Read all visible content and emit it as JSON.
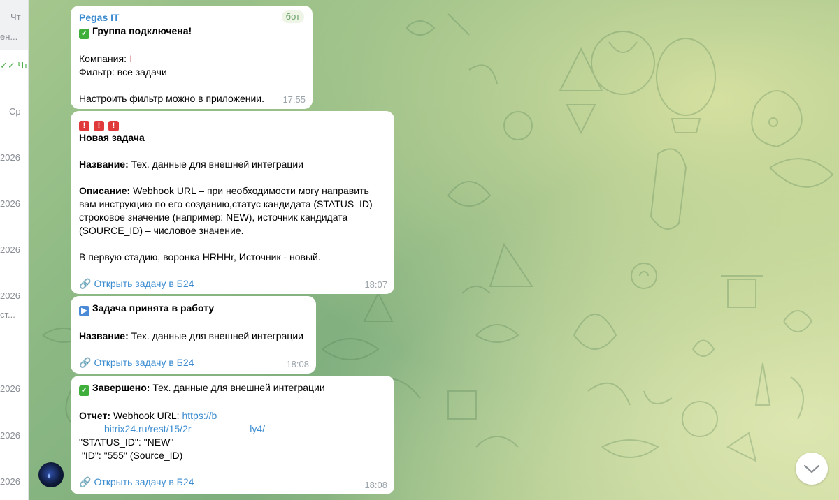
{
  "sidebar": {
    "items": [
      {
        "top": "Чт",
        "bottom": "ен..."
      },
      {
        "top": "✓✓ Чт",
        "bottom": ""
      },
      {
        "top": "Ср",
        "bottom": ""
      },
      {
        "top": "2026",
        "bottom": ""
      },
      {
        "top": "2026",
        "bottom": ""
      },
      {
        "top": "2026",
        "bottom": ""
      },
      {
        "top": "2026",
        "bottom": "ст..."
      },
      {
        "top": "2026",
        "bottom": ""
      },
      {
        "top": "2026",
        "bottom": ""
      },
      {
        "top": "2026",
        "bottom": ""
      }
    ]
  },
  "messages": {
    "m1": {
      "sender": "Pegas IT",
      "badge": "бот",
      "title": "Группа подключена!",
      "company_label": "Компания:",
      "company_value": "",
      "filter": "Фильтр: все задачи",
      "hint": "Настроить фильтр можно в приложении.",
      "time": "17:55"
    },
    "m2": {
      "heading": "Новая задача",
      "name_label": "Название:",
      "name_value": "Тех. данные для внешней интеграции",
      "desc_label": "Описание:",
      "desc_line1": "Webhook URL – при необходимости могу направить",
      "desc_line2": "вам инструкцию по его созданию,статус кандидата (STATUS_ID) –",
      "desc_line3": "строковое значение (например: NEW), источник кандидата",
      "desc_line4": "(SOURCE_ID) – числовое значение.",
      "note": "В первую стадию, воронка HRHHr, Источник - новый.",
      "link": "Открыть задачу в Б24",
      "time": "18:07"
    },
    "m3": {
      "heading": "Задача принята в работу",
      "name_label": "Название:",
      "name_value": "Тех. данные для внешней интеграции",
      "link": "Открыть задачу в Б24",
      "time": "18:08"
    },
    "m4": {
      "done_label": "Завершено:",
      "done_value": "Тех. данные для внешней интеграции",
      "report_label": "Отчет:",
      "report_value": "Webhook URL:",
      "url_part1": "https://b",
      "url_part2": "bitrix24.ru/rest/15/2r",
      "url_part3": "ly4/",
      "line_status": "\"STATUS_ID\": \"NEW\"",
      "line_id": " \"ID\": \"555\" (Source_ID)",
      "link": "Открыть задачу в Б24",
      "time": "18:08"
    }
  },
  "icons": {
    "check": "white-check-mark-icon",
    "play": "play-button-icon",
    "alarm": "police-light-icon",
    "link": "link-icon",
    "scroll": "chevron-down-icon"
  },
  "colors": {
    "accent": "#3a8bd0",
    "bubble": "#ffffff",
    "time": "#9aa3aa"
  }
}
